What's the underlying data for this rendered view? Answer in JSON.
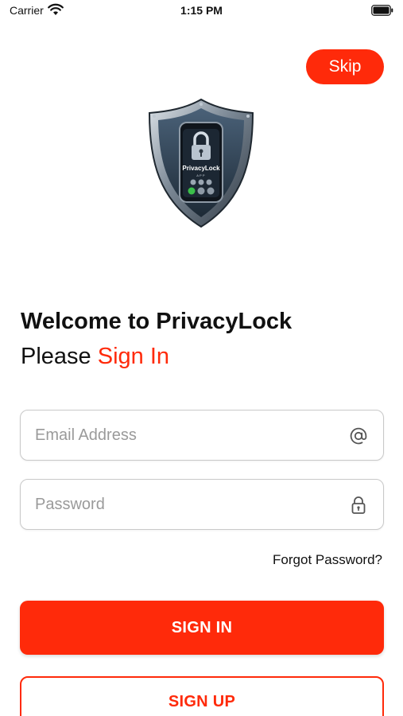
{
  "status_bar": {
    "carrier": "Carrier",
    "time": "1:15 PM",
    "wifi_icon": "wifi-icon",
    "battery_icon": "battery-icon"
  },
  "header": {
    "skip_label": "Skip"
  },
  "logo": {
    "icon": "shield-phone-lock-logo",
    "text": "PrivacyLock",
    "subtext": "APP"
  },
  "welcome": {
    "line1": "Welcome to PrivacyLock",
    "line2_prefix": "Please ",
    "line2_accent": "Sign In"
  },
  "form": {
    "email": {
      "value": "",
      "placeholder": "Email Address",
      "icon": "at-sign-icon"
    },
    "password": {
      "value": "",
      "placeholder": "Password",
      "icon": "padlock-icon"
    },
    "forgot_label": "Forgot Password?"
  },
  "actions": {
    "sign_in_label": "SIGN IN",
    "sign_up_label": "SIGN UP"
  },
  "colors": {
    "accent": "#ff2a0a",
    "text": "#111111",
    "placeholder": "#9a9a9a",
    "border": "#c9c9c9"
  }
}
